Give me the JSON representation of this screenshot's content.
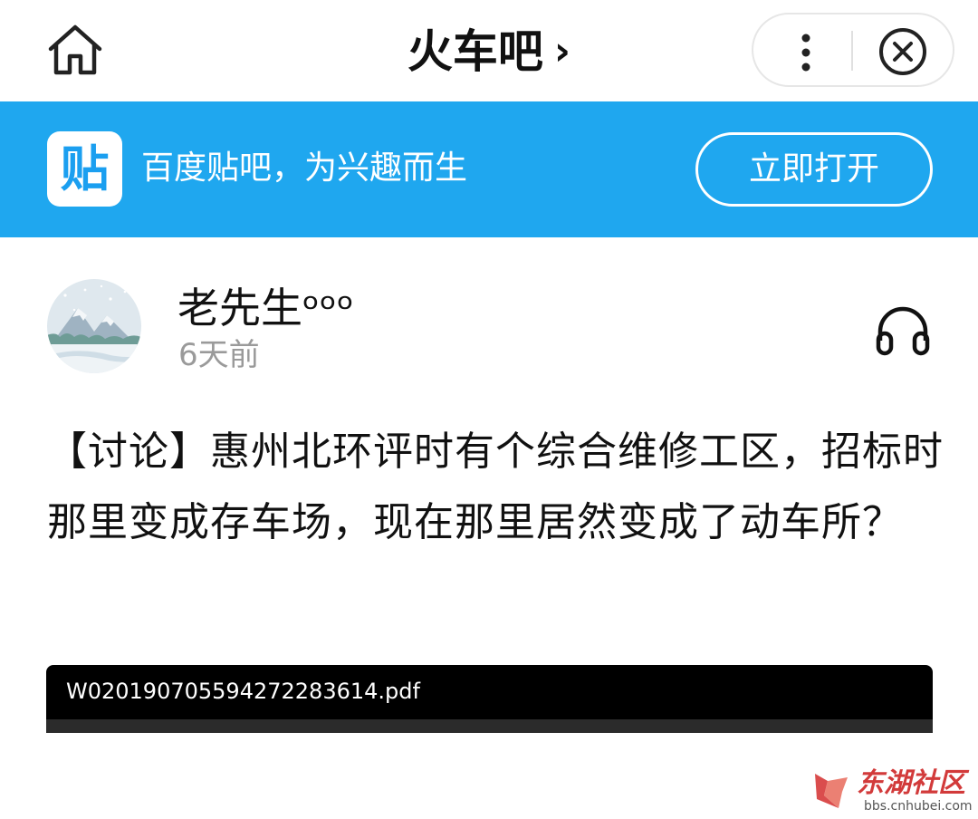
{
  "nav": {
    "home_icon": "home-icon",
    "title": "火车吧",
    "title_chevron": "›",
    "more_icon": "more-vertical-icon",
    "close_icon": "close-circle-icon"
  },
  "banner": {
    "background_color": "#1fa7ef",
    "logo_char": "贴",
    "slogan": "百度贴吧，为兴趣而生",
    "open_button": "立即打开"
  },
  "post": {
    "author": {
      "avatar_icon": "snow-mountain-avatar",
      "name": "老先生ᵒᵒᵒ",
      "time": "6天前"
    },
    "listen_icon": "headphones-icon",
    "title": "【讨论】惠州北环评时有个综合维修工区，招标时那里变成存车场，现在那里居然变成了动车所？",
    "attachment": {
      "filename": "W020190705594272283614.pdf"
    }
  },
  "watermark": {
    "name": "东湖社区",
    "url": "bbs.cnhubei.com"
  }
}
